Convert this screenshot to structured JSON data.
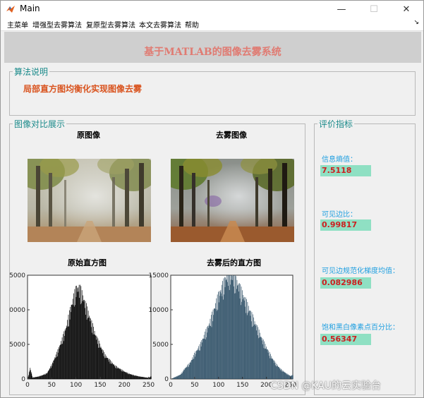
{
  "window": {
    "title": "Main",
    "min_glyph": "—",
    "max_glyph": "☐",
    "close_glyph": "✕"
  },
  "menu": {
    "items": [
      "主菜单",
      "增强型去雾算法",
      "复原型去雾算法",
      "本文去雾算法",
      "帮助"
    ],
    "overflow_glyph": "↘"
  },
  "header": {
    "title": "基于MATLAB的图像去雾系统"
  },
  "algorithm_panel": {
    "title": "算法说明",
    "description": "局部直方图均衡化实现图像去雾"
  },
  "comparison_panel": {
    "title": "图像对比展示",
    "original_image_title": "原图像",
    "dehazed_image_title": "去雾图像",
    "original_hist_title": "原始直方图",
    "dehazed_hist_title": "去雾后的直方图"
  },
  "metrics_panel": {
    "title": "评价指标",
    "entropy_label": "信息熵值：",
    "entropy_value": "7.5118",
    "visible_edge_label": "可见边比：",
    "visible_edge_value": "0.99817",
    "gradient_label": "可见边规范化梯度均值：",
    "gradient_value": "0.082986",
    "saturation_label": "饱和黑白像素点百分比：",
    "saturation_value": "0.56347"
  },
  "watermark": "CSDN @KAU的云实验台",
  "colors": {
    "accent_title": "#e07b72",
    "panel_title": "#1a8a8a",
    "algo_text": "#d9531e",
    "metric_label": "#1f9fe0",
    "metric_box": "#8fe0c3",
    "metric_value": "#cc1f1f",
    "hist_original": "#000000",
    "hist_dehazed": "#2e4f66"
  },
  "chart_data": [
    {
      "type": "bar",
      "title": "原始直方图",
      "xlim": [
        0,
        255
      ],
      "ylim": [
        0,
        5000
      ],
      "xticks": [
        "0",
        "50",
        "100",
        "150",
        "200",
        "250"
      ],
      "yticks": [
        "0",
        "5000",
        "0000",
        "5000"
      ],
      "series": [
        {
          "x": [
            0,
            5,
            10,
            20,
            30,
            40,
            50,
            60,
            70,
            80,
            90,
            100,
            105,
            110,
            115,
            120,
            130,
            140,
            150,
            160,
            170,
            180,
            190,
            200,
            210,
            220,
            230,
            240,
            250,
            255
          ],
          "values": [
            0,
            1500,
            200,
            300,
            500,
            800,
            2000,
            3500,
            5200,
            7200,
            10000,
            12300,
            12500,
            12000,
            11000,
            10000,
            8000,
            6000,
            4500,
            3200,
            2500,
            1800,
            1400,
            1000,
            700,
            500,
            350,
            250,
            150,
            400
          ]
        }
      ]
    },
    {
      "type": "bar",
      "title": "去雾后的直方图",
      "xlim": [
        0,
        255
      ],
      "ylim": [
        0,
        15000
      ],
      "xticks": [
        "0",
        "50",
        "100",
        "150",
        "200",
        "250"
      ],
      "yticks": [
        "0",
        "5000",
        "10000",
        "15000"
      ],
      "series": [
        {
          "x": [
            0,
            10,
            20,
            30,
            40,
            50,
            60,
            70,
            80,
            90,
            100,
            110,
            120,
            130,
            140,
            150,
            160,
            170,
            180,
            190,
            200,
            210,
            220,
            230,
            240,
            250,
            255
          ],
          "values": [
            0,
            300,
            600,
            1500,
            2200,
            3500,
            4500,
            6000,
            7500,
            9500,
            11500,
            13000,
            14500,
            14000,
            13000,
            11500,
            10000,
            8500,
            7000,
            5500,
            4200,
            3000,
            2000,
            1300,
            800,
            400,
            600
          ]
        }
      ]
    }
  ]
}
